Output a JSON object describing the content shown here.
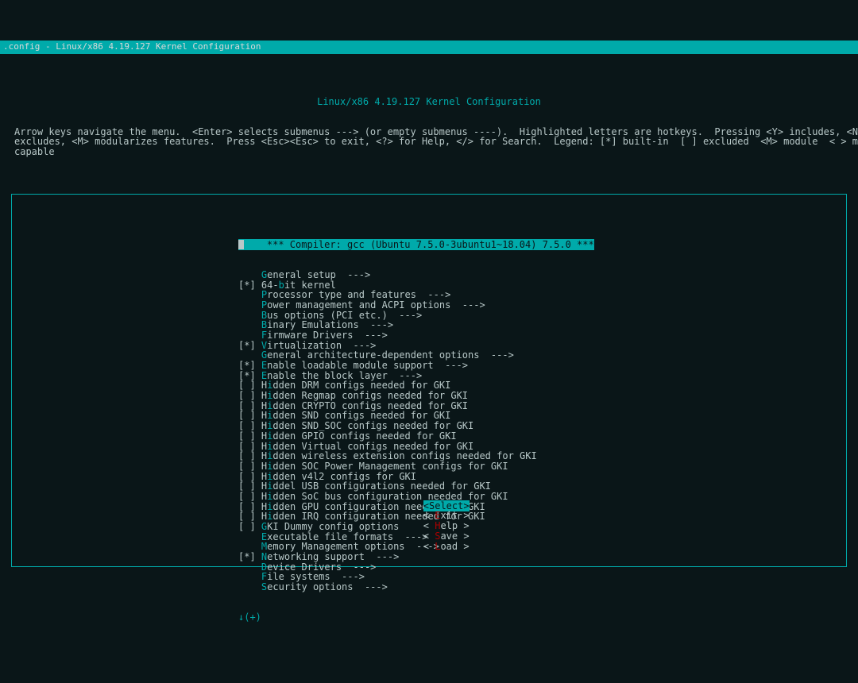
{
  "window": {
    "titlebar": ".config - Linux/x86 4.19.127 Kernel Configuration"
  },
  "header": {
    "title": "Linux/x86 4.19.127 Kernel Configuration",
    "help": "Arrow keys navigate the menu.  <Enter> selects submenus ---> (or empty submenus ----).  Highlighted letters are hotkeys.  Pressing <Y> includes, <N>\nexcludes, <M> modularizes features.  Press <Esc><Esc> to exit, <?> for Help, </> for Search.  Legend: [*] built-in  [ ] excluded  <M> module  < > module\ncapable"
  },
  "menu": {
    "selected_prefix": "    ",
    "selected_text": "*** Compiler: gcc (Ubuntu 7.5.0-3ubuntu1~18.04) 7.5.0 ***",
    "items": [
      {
        "mark": "    ",
        "h": "G",
        "rest": "eneral setup  --->"
      },
      {
        "mark": "[*] ",
        "pre": "64-",
        "h": "b",
        "rest": "it kernel"
      },
      {
        "mark": "    ",
        "h": "P",
        "rest": "rocessor type and features  --->"
      },
      {
        "mark": "    ",
        "h": "P",
        "rest": "ower management and ACPI options  --->"
      },
      {
        "mark": "    ",
        "h": "B",
        "rest": "us options (PCI etc.)  --->"
      },
      {
        "mark": "    ",
        "h": "B",
        "rest": "inary Emulations  --->"
      },
      {
        "mark": "    ",
        "h": "F",
        "rest": "irmware Drivers  --->"
      },
      {
        "mark": "[*] ",
        "h": "V",
        "rest": "irtualization  --->"
      },
      {
        "mark": "    ",
        "h": "G",
        "rest": "eneral architecture-dependent options  --->"
      },
      {
        "mark": "[*] ",
        "h": "E",
        "rest": "nable loadable module support  --->"
      },
      {
        "mark": "[*] ",
        "h": "E",
        "rest": "nable the block layer  --->"
      },
      {
        "mark": "[ ] ",
        "pre": "H",
        "h": "i",
        "rest": "dden DRM configs needed for GKI"
      },
      {
        "mark": "[ ] ",
        "pre": "H",
        "h": "i",
        "rest": "dden Regmap configs needed for GKI"
      },
      {
        "mark": "[ ] ",
        "pre": "H",
        "h": "i",
        "rest": "dden CRYPTO configs needed for GKI"
      },
      {
        "mark": "[ ] ",
        "pre": "H",
        "h": "i",
        "rest": "dden SND configs needed for GKI"
      },
      {
        "mark": "[ ] ",
        "pre": "H",
        "h": "i",
        "rest": "dden SND_SOC configs needed for GKI"
      },
      {
        "mark": "[ ] ",
        "pre": "H",
        "h": "i",
        "rest": "dden GPIO configs needed for GKI"
      },
      {
        "mark": "[ ] ",
        "pre": "H",
        "h": "i",
        "rest": "dden Virtual configs needed for GKI"
      },
      {
        "mark": "[ ] ",
        "pre": "H",
        "h": "i",
        "rest": "dden wireless extension configs needed for GKI"
      },
      {
        "mark": "[ ] ",
        "pre": "H",
        "h": "i",
        "rest": "dden SOC Power Management configs for GKI"
      },
      {
        "mark": "[ ] ",
        "pre": "H",
        "h": "i",
        "rest": "dden v4l2 configs for GKI"
      },
      {
        "mark": "[ ] ",
        "pre": "H",
        "h": "i",
        "rest": "ddel USB configurations needed for GKI"
      },
      {
        "mark": "[ ] ",
        "pre": "H",
        "h": "i",
        "rest": "dden SoC bus configuration needed for GKI"
      },
      {
        "mark": "[ ] ",
        "pre": "H",
        "h": "i",
        "rest": "dden GPU configuration needed for GKI"
      },
      {
        "mark": "[ ] ",
        "pre": "H",
        "h": "i",
        "rest": "dden IRQ configuration needed for GKI"
      },
      {
        "mark": "[ ] ",
        "h": "G",
        "rest": "KI Dummy config options"
      },
      {
        "mark": "    ",
        "h": "E",
        "rest": "xecutable file formats  --->"
      },
      {
        "mark": "    ",
        "h": "M",
        "rest": "emory Management options  --->"
      },
      {
        "mark": "[*] ",
        "h": "N",
        "rest": "etworking support  --->"
      },
      {
        "mark": "    ",
        "h": "D",
        "rest": "evice Drivers  --->"
      },
      {
        "mark": "    ",
        "h": "F",
        "rest": "ile systems  --->"
      },
      {
        "mark": "    ",
        "h": "S",
        "rest": "ecurity options  --->"
      }
    ],
    "more_indicator": "↓(+)"
  },
  "buttons": {
    "select": {
      "bracket_l": "<",
      "hk": "S",
      "rest": "elect>",
      "bracket_r": ""
    },
    "exit": {
      "bracket_l": "< ",
      "hk": "E",
      "rest": "xit ",
      "bracket_r": ">"
    },
    "help": {
      "bracket_l": "< ",
      "hk": "H",
      "rest": "elp ",
      "bracket_r": ">"
    },
    "save": {
      "bracket_l": "< ",
      "hk": "S",
      "rest": "ave ",
      "bracket_r": ">"
    },
    "load": {
      "bracket_l": "< ",
      "hk": "L",
      "rest": "oad ",
      "bracket_r": ">"
    }
  }
}
